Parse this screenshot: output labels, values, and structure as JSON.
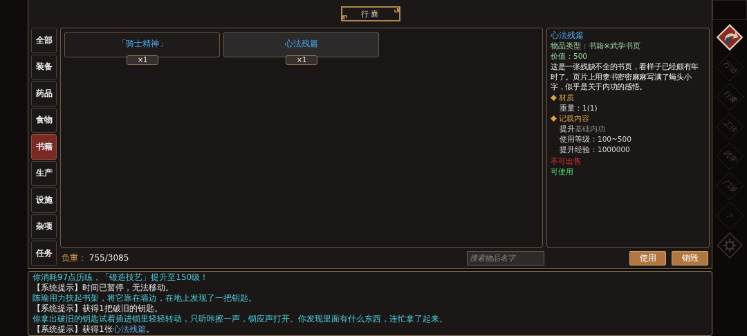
{
  "title": "行囊",
  "tabs": [
    {
      "label": "全部",
      "selected": false
    },
    {
      "label": "装备",
      "selected": false
    },
    {
      "label": "药品",
      "selected": false
    },
    {
      "label": "食物",
      "selected": false
    },
    {
      "label": "书籍",
      "selected": true
    },
    {
      "label": "生产",
      "selected": false
    },
    {
      "label": "设施",
      "selected": false
    },
    {
      "label": "杂项",
      "selected": false
    },
    {
      "label": "任务",
      "selected": false
    }
  ],
  "items": [
    {
      "name": "「骑士精神」",
      "count": "×1",
      "selected": false
    },
    {
      "name": "心法残篇",
      "count": "×1",
      "selected": true
    }
  ],
  "detail": {
    "name": "心法残篇",
    "type": "物品类型：书籍※武学书页",
    "value": "价值：500",
    "description": "这是一张残缺不全的书页，看样子已经颇有年时了。页片上用隶书密密麻麻写满了蝇头小字，似乎是关于内功的感悟。",
    "sections": [
      {
        "title": "材质",
        "lines": [
          {
            "text": "重量：1(1)"
          }
        ]
      },
      {
        "title": "记载内容",
        "lines": [
          {
            "text": "提升",
            "dim": "基础内功"
          },
          {
            "text": "使用等级：100~500"
          },
          {
            "text": "提升经验：1000000"
          }
        ]
      }
    ],
    "flags": [
      {
        "text": "不可出售",
        "kind": "bad"
      },
      {
        "text": "可使用",
        "kind": "good"
      }
    ]
  },
  "weight": {
    "label": "负重：",
    "value": "755/3085"
  },
  "search": {
    "placeholder": "搜索物品名字"
  },
  "buttons": [
    "使用",
    "销毁"
  ],
  "log": [
    [
      {
        "text": "你消耗97点历练，「锻造技艺」提升至150级！",
        "kind": "story"
      }
    ],
    [
      {
        "text": "【系统提示】时间已暂停，无法移动。",
        "kind": "system"
      }
    ],
    [
      {
        "text": "陈瑜用力扶起书架，将它靠在墙边，在地上发现了一把钥匙。",
        "kind": "story"
      }
    ],
    [
      {
        "text": "【系统提示】获得1把破旧的钥匙。",
        "kind": "system"
      }
    ],
    [
      {
        "text": "你拿出破旧的钥匙试着插进锁里轻轻转动，只听咔擦一声，锁应声打开。你发现里面有什么东西，连忙拿了起来。",
        "kind": "story"
      }
    ],
    [
      {
        "text": "【系统提示】获得1张",
        "kind": "system"
      },
      {
        "text": "心法残篇",
        "kind": "item"
      },
      {
        "text": "。",
        "kind": "system"
      }
    ]
  ],
  "side_nav": [
    {
      "kind": "emblem",
      "selected": true
    },
    {
      "kind": "text",
      "label": "行动",
      "selected": false
    },
    {
      "kind": "text",
      "label": "行囊",
      "selected": false
    },
    {
      "kind": "text",
      "label": "工作",
      "selected": false
    },
    {
      "kind": "text",
      "label": "武学",
      "selected": false
    },
    {
      "kind": "text",
      "label": "门派",
      "selected": false
    },
    {
      "kind": "text",
      "label": "?",
      "selected": false
    },
    {
      "kind": "gear",
      "selected": false
    }
  ]
}
